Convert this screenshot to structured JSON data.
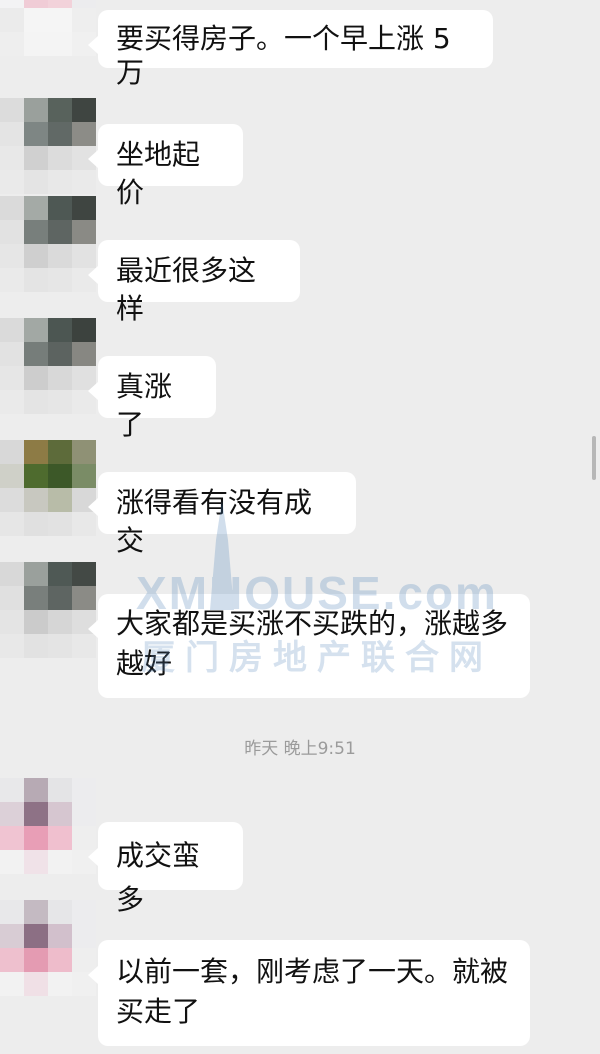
{
  "colors": {
    "background": "#ededed",
    "bubble": "#ffffff",
    "timestamp_text": "#9b9b9b",
    "watermark": "#4a80b8"
  },
  "messages": [
    {
      "text": "要买得房子。一个早上涨 5 万",
      "avatar_colors": [
        "#e8e8ea",
        "#d9d3d8",
        "#f0f0f1",
        "#ececee",
        "#f3f3f4",
        "#f0ccd6",
        "#f2d2da",
        "#ececee",
        "#ebebeb",
        "#f5f5f5",
        "#f5f5f5",
        "#eeeeee",
        "#eeeeee",
        "#f4f4f4",
        "#f4f4f4",
        "#f0f0f0"
      ]
    },
    {
      "text": "坐地起价",
      "avatar_colors": [
        "#dcdcdc",
        "#9aa09c",
        "#58625c",
        "#3f4541",
        "#e4e4e4",
        "#7e8684",
        "#616966",
        "#8c8c87",
        "#e8e8e8",
        "#d0d0d0",
        "#dcdcdc",
        "#e2e2e2",
        "#eaeaea",
        "#e4e4e4",
        "#e8e8e8",
        "#eaeaea"
      ]
    },
    {
      "text": "最近很多这样",
      "avatar_colors": [
        "#dadada",
        "#a4aaa6",
        "#4e5854",
        "#3f4541",
        "#e2e2e2",
        "#787f7c",
        "#5e6562",
        "#8a8a85",
        "#e6e6e6",
        "#cfcfcf",
        "#dadada",
        "#e2e2e2",
        "#eaeaea",
        "#e4e4e4",
        "#e6e6e6",
        "#eaeaea"
      ]
    },
    {
      "text": "真涨了",
      "avatar_colors": [
        "#dadada",
        "#a2a8a4",
        "#4c5652",
        "#3c423e",
        "#e2e2e2",
        "#767d7a",
        "#5c6360",
        "#878782",
        "#e6e6e6",
        "#cdcdcd",
        "#d8d8d8",
        "#e0e0e0",
        "#eaeaea",
        "#e4e4e4",
        "#e6e6e6",
        "#eaeaea"
      ]
    },
    {
      "text": "涨得看有没有成交",
      "avatar_colors": [
        "#d8d8d8",
        "#8d7b45",
        "#5d6b3a",
        "#8f9175",
        "#cfd0c8",
        "#4e6b2e",
        "#3c5828",
        "#7a8c66",
        "#dcdcdc",
        "#c8c8c0",
        "#b8bca8",
        "#d8d8d8",
        "#e6e6e6",
        "#e0e0e0",
        "#e2e2e2",
        "#e8e8e8"
      ]
    },
    {
      "text": "大家都是买涨不买跌的，涨越多越好",
      "avatar_colors": [
        "#d8d8d8",
        "#9aa09c",
        "#4f5955",
        "#434945",
        "#e0e0e0",
        "#797f7c",
        "#5e6562",
        "#8b8b86",
        "#e4e4e4",
        "#cbcbcb",
        "#d6d6d6",
        "#dedede",
        "#e8e8e8",
        "#e2e2e2",
        "#e4e4e4",
        "#e8e8e8"
      ]
    },
    {
      "text": "成交蛮多",
      "avatar_colors": [
        "#e8e8ea",
        "#b7aab4",
        "#e4e4e6",
        "#ececee",
        "#dcd0d8",
        "#8e7286",
        "#d6c6d0",
        "#ececee",
        "#f0c4d2",
        "#e89eb6",
        "#f0c0cf",
        "#eeeeee",
        "#f2f2f2",
        "#f0e2e8",
        "#f2f2f2",
        "#f0f0f0"
      ]
    },
    {
      "text": "以前一套，刚考虑了一天。就被买走了",
      "avatar_colors": [
        "#e8e8ea",
        "#c4bac2",
        "#e6e6e8",
        "#ececee",
        "#d8ccd4",
        "#8c6f84",
        "#d2c0cc",
        "#ececee",
        "#eec0ce",
        "#e49bb2",
        "#eebccb",
        "#eeeeee",
        "#f2f2f2",
        "#f0e0e6",
        "#f2f2f2",
        "#f0f0f0"
      ]
    }
  ],
  "timestamp": "昨天 晚上9:51",
  "watermark": {
    "logo_text": "XMHOUSE.com",
    "subtitle": "厦门房地产联合网"
  }
}
